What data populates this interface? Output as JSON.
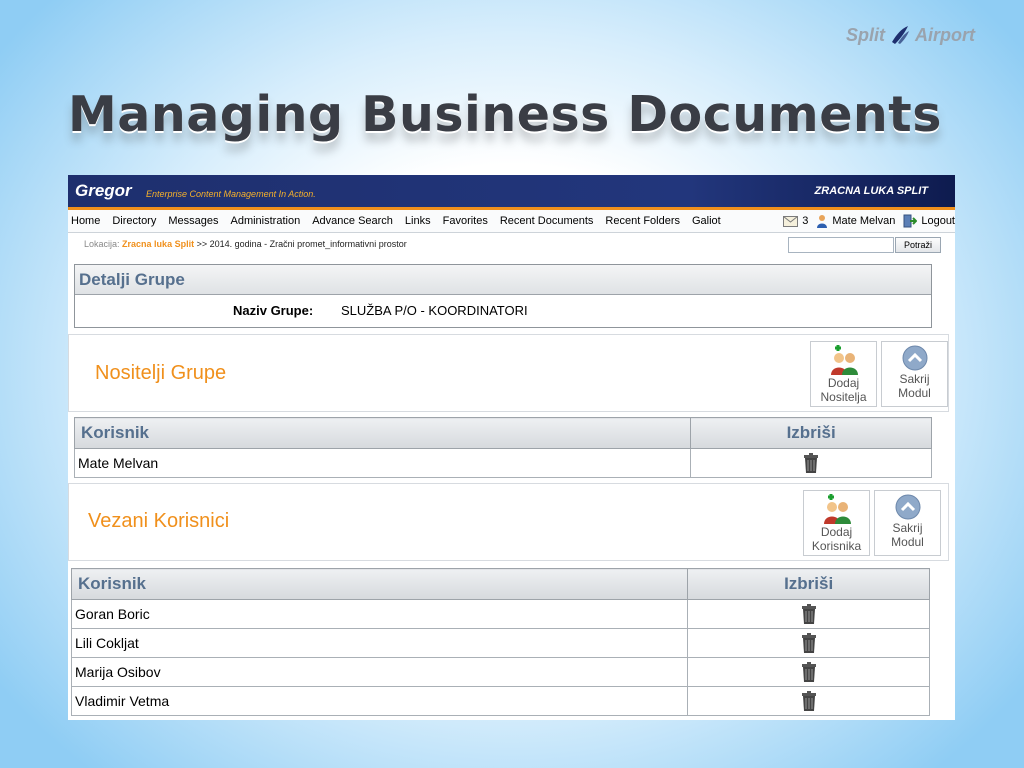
{
  "brand": {
    "left": "Split",
    "right": "Airport"
  },
  "slide_title": "Managing Business Documents",
  "app": {
    "logo": "Gregor",
    "tagline": "Enterprise Content Management In Action.",
    "organization": "ZRACNA LUKA SPLIT",
    "nav": [
      "Home",
      "Directory",
      "Messages",
      "Administration",
      "Advance Search",
      "Links",
      "Favorites",
      "Recent Documents",
      "Recent Folders",
      "Galiot"
    ],
    "message_count": "3",
    "user_name": "Mate Melvan",
    "logout_label": "Logout",
    "breadcrumb": {
      "label": "Lokacija:",
      "link": "Zracna luka Split",
      "path": ">> 2014. godina - Zračni promet_informativni prostor"
    },
    "search": {
      "value": "",
      "button": "Potraži"
    },
    "group_details": {
      "title": "Detalji Grupe",
      "name_label": "Naziv Grupe:",
      "name_value": "SLUŽBA P/O - KOORDINATORI"
    },
    "holders": {
      "title": "Nositelji Grupe",
      "add_button": [
        "Dodaj",
        "Nositelja"
      ],
      "hide_button": [
        "Sakrij",
        "Modul"
      ],
      "columns": [
        "Korisnik",
        "Izbriši"
      ],
      "rows": [
        "Mate Melvan"
      ]
    },
    "linked_users": {
      "title": "Vezani Korisnici",
      "add_button": [
        "Dodaj",
        "Korisnika"
      ],
      "hide_button": [
        "Sakrij",
        "Modul"
      ],
      "columns": [
        "Korisnik",
        "Izbriši"
      ],
      "rows": [
        "Goran Boric",
        "Lili Cokljat",
        "Marija Osibov",
        "Vladimir Vetma"
      ]
    }
  },
  "colors": {
    "accent_orange": "#f0901c",
    "header_navy": "#1e2f6e",
    "header_text": "#56708e"
  }
}
